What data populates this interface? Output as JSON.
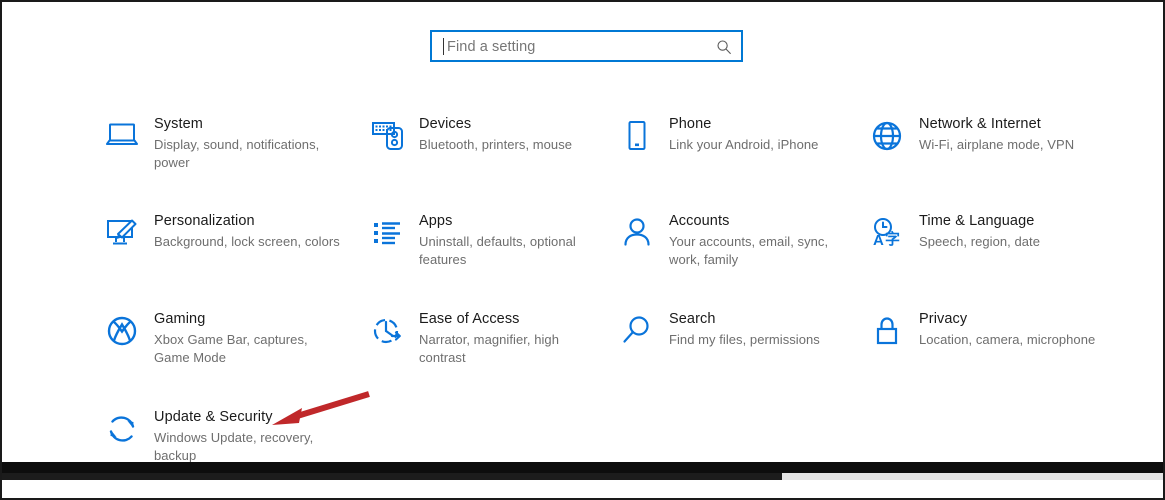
{
  "search": {
    "placeholder": "Find a setting",
    "value": "",
    "icon": "search-icon"
  },
  "accent_color": "#0078d4",
  "annotation": {
    "color": "#c0282a",
    "points_to": "Update & Security"
  },
  "tiles": [
    {
      "title": "System",
      "subtitle": "Display, sound, notifications, power",
      "icon": "laptop-icon"
    },
    {
      "title": "Devices",
      "subtitle": "Bluetooth, printers, mouse",
      "icon": "keyboard-mouse-icon"
    },
    {
      "title": "Phone",
      "subtitle": "Link your Android, iPhone",
      "icon": "phone-icon"
    },
    {
      "title": "Network & Internet",
      "subtitle": "Wi-Fi, airplane mode, VPN",
      "icon": "globe-icon"
    },
    {
      "title": "Personalization",
      "subtitle": "Background, lock screen, colors",
      "icon": "monitor-brush-icon"
    },
    {
      "title": "Apps",
      "subtitle": "Uninstall, defaults, optional features",
      "icon": "list-icon"
    },
    {
      "title": "Accounts",
      "subtitle": "Your accounts, email, sync, work, family",
      "icon": "person-icon"
    },
    {
      "title": "Time & Language",
      "subtitle": "Speech, region, date",
      "icon": "clock-language-icon"
    },
    {
      "title": "Gaming",
      "subtitle": "Xbox Game Bar, captures, Game Mode",
      "icon": "xbox-icon"
    },
    {
      "title": "Ease of Access",
      "subtitle": "Narrator, magnifier, high contrast",
      "icon": "accessibility-clock-icon"
    },
    {
      "title": "Search",
      "subtitle": "Find my files, permissions",
      "icon": "magnifier-icon"
    },
    {
      "title": "Privacy",
      "subtitle": "Location, camera, microphone",
      "icon": "lock-icon"
    },
    {
      "title": "Update & Security",
      "subtitle": "Windows Update, recovery, backup",
      "icon": "refresh-icon"
    }
  ]
}
